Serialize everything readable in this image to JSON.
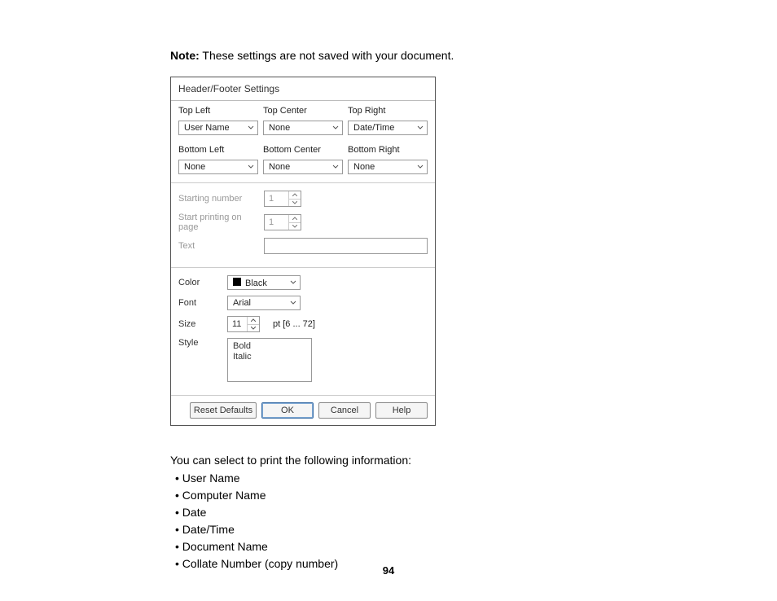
{
  "note": {
    "label": "Note:",
    "text": "These settings are not saved with your document."
  },
  "dialog": {
    "title": "Header/Footer Settings",
    "positions": {
      "topLeft": {
        "label": "Top Left",
        "value": "User Name"
      },
      "topCenter": {
        "label": "Top Center",
        "value": "None"
      },
      "topRight": {
        "label": "Top Right",
        "value": "Date/Time"
      },
      "bottomLeft": {
        "label": "Bottom Left",
        "value": "None"
      },
      "bottomCenter": {
        "label": "Bottom Center",
        "value": "None"
      },
      "bottomRight": {
        "label": "Bottom Right",
        "value": "None"
      }
    },
    "startingNumber": {
      "label": "Starting number",
      "value": "1"
    },
    "startPrinting": {
      "label": "Start printing on page",
      "value": "1"
    },
    "text": {
      "label": "Text",
      "value": ""
    },
    "color": {
      "label": "Color",
      "value": "Black"
    },
    "font": {
      "label": "Font",
      "value": "Arial"
    },
    "size": {
      "label": "Size",
      "value": "11",
      "range": "pt  [6 ... 72]"
    },
    "style": {
      "label": "Style",
      "options": {
        "bold": "Bold",
        "italic": "Italic"
      }
    },
    "buttons": {
      "reset": "Reset Defaults",
      "ok": "OK",
      "cancel": "Cancel",
      "help": "Help"
    }
  },
  "afterText": {
    "intro": "You can select to print the following information:",
    "items": {
      "a": "User Name",
      "b": "Computer Name",
      "c": "Date",
      "d": "Date/Time",
      "e": "Document Name",
      "f": "Collate Number (copy number)"
    }
  },
  "pageNumber": "94"
}
